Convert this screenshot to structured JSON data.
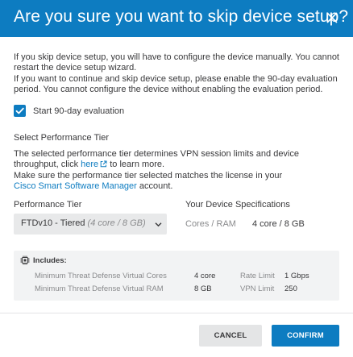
{
  "dialog": {
    "title": "Are you sure you want to skip device setup?",
    "intro_lines": [
      "If you skip device setup, you will have to configure the device manually. You cannot",
      "restart the device setup wizard.",
      "If you want to continue and skip device setup, please enable the 90-day evaluation",
      "period. You cannot configure the device without enabling the evaluation period."
    ],
    "evaluation_checkbox": {
      "label": "Start 90-day evaluation",
      "checked": true
    },
    "performance_section_title": "Select Performance Tier",
    "tier_text": {
      "line1": "The selected performance tier determines VPN session limits and device",
      "line2_before": "throughput, click ",
      "line2_link": "here",
      "line2_after": " to learn more.",
      "line3": "Make sure the performance tier selected matches the license in your",
      "line4_link": "Cisco Smart Software Manager",
      "line4_after": " account."
    },
    "tier_label": "Performance Tier",
    "tier_select": {
      "value": "FTDv10 - Tiered",
      "detail": "(4 core / 8 GB)"
    },
    "specs_label": "Your Device Specifications",
    "specs": {
      "key": "Cores / RAM",
      "value": "4 core / 8 GB"
    },
    "includes": {
      "title": "Includes:",
      "rows": [
        {
          "key": "Minimum Threat Defense Virtual Cores",
          "value": "4 core",
          "key2": "Rate Limit",
          "value2": "1 Gbps"
        },
        {
          "key": "Minimum Threat Defense Virtual RAM",
          "value": "8 GB",
          "key2": "VPN Limit",
          "value2": "250"
        }
      ]
    },
    "buttons": {
      "cancel": "CANCEL",
      "confirm": "CONFIRM"
    }
  },
  "colors": {
    "primary": "#0d7cc1",
    "text": "#39393b",
    "muted": "#8a8b8d",
    "panel": "#f2f3f4"
  },
  "icons": {
    "close": "close-icon",
    "checkbox": "checkmark-icon",
    "external": "external-link-icon",
    "chevron": "chevron-down-icon",
    "includes": "chip-icon"
  }
}
